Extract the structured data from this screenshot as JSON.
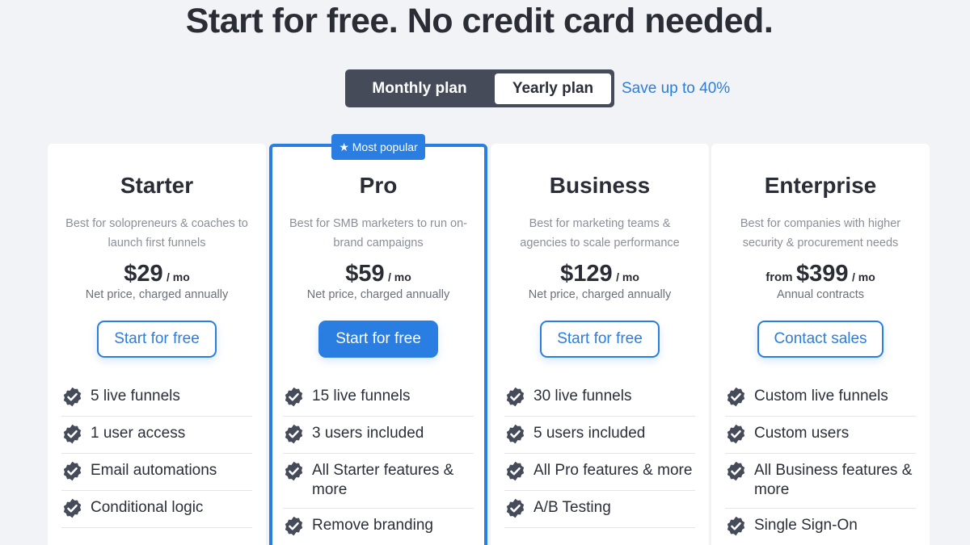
{
  "headline": "Start for free. No credit card needed.",
  "billing_toggle": {
    "monthly_label": "Monthly plan",
    "yearly_label": "Yearly plan",
    "selected": "Yearly plan",
    "save_text": "Save up to 40%"
  },
  "colors": {
    "accent": "#2a7de1",
    "toggle_bg": "#454b58",
    "check_icon": "#454b58",
    "page_bg": "#f2f3f6"
  },
  "plans": [
    {
      "name": "Starter",
      "description": "Best for solopreneurs & coaches to launch first funnels",
      "from": "",
      "price": "$29",
      "per": "/ mo",
      "note": "Net price, charged annually",
      "cta": "Start for free",
      "features": [
        "5 live funnels",
        "1 user access",
        "Email automations",
        "Conditional logic"
      ]
    },
    {
      "name": "Pro",
      "badge": "★ Most popular",
      "description": "Best for SMB marketers to run on-brand campaigns",
      "from": "",
      "price": "$59",
      "per": "/ mo",
      "note": "Net price, charged annually",
      "cta": "Start for free",
      "features": [
        "15 live funnels",
        "3 users included",
        "All Starter features & more",
        "Remove branding"
      ]
    },
    {
      "name": "Business",
      "description": "Best for marketing teams & agencies to scale performance",
      "from": "",
      "price": "$129",
      "per": "/ mo",
      "note": "Net price, charged annually",
      "cta": "Start for free",
      "features": [
        "30 live funnels",
        "5 users included",
        "All Pro features & more",
        "A/B Testing"
      ]
    },
    {
      "name": "Enterprise",
      "description": "Best for companies with higher security & procurement needs",
      "from": "from",
      "price": "$399",
      "per": "/ mo",
      "note": "Annual contracts",
      "cta": "Contact sales",
      "features": [
        "Custom live funnels",
        "Custom users",
        "All Business features & more",
        "Single Sign-On"
      ]
    }
  ]
}
